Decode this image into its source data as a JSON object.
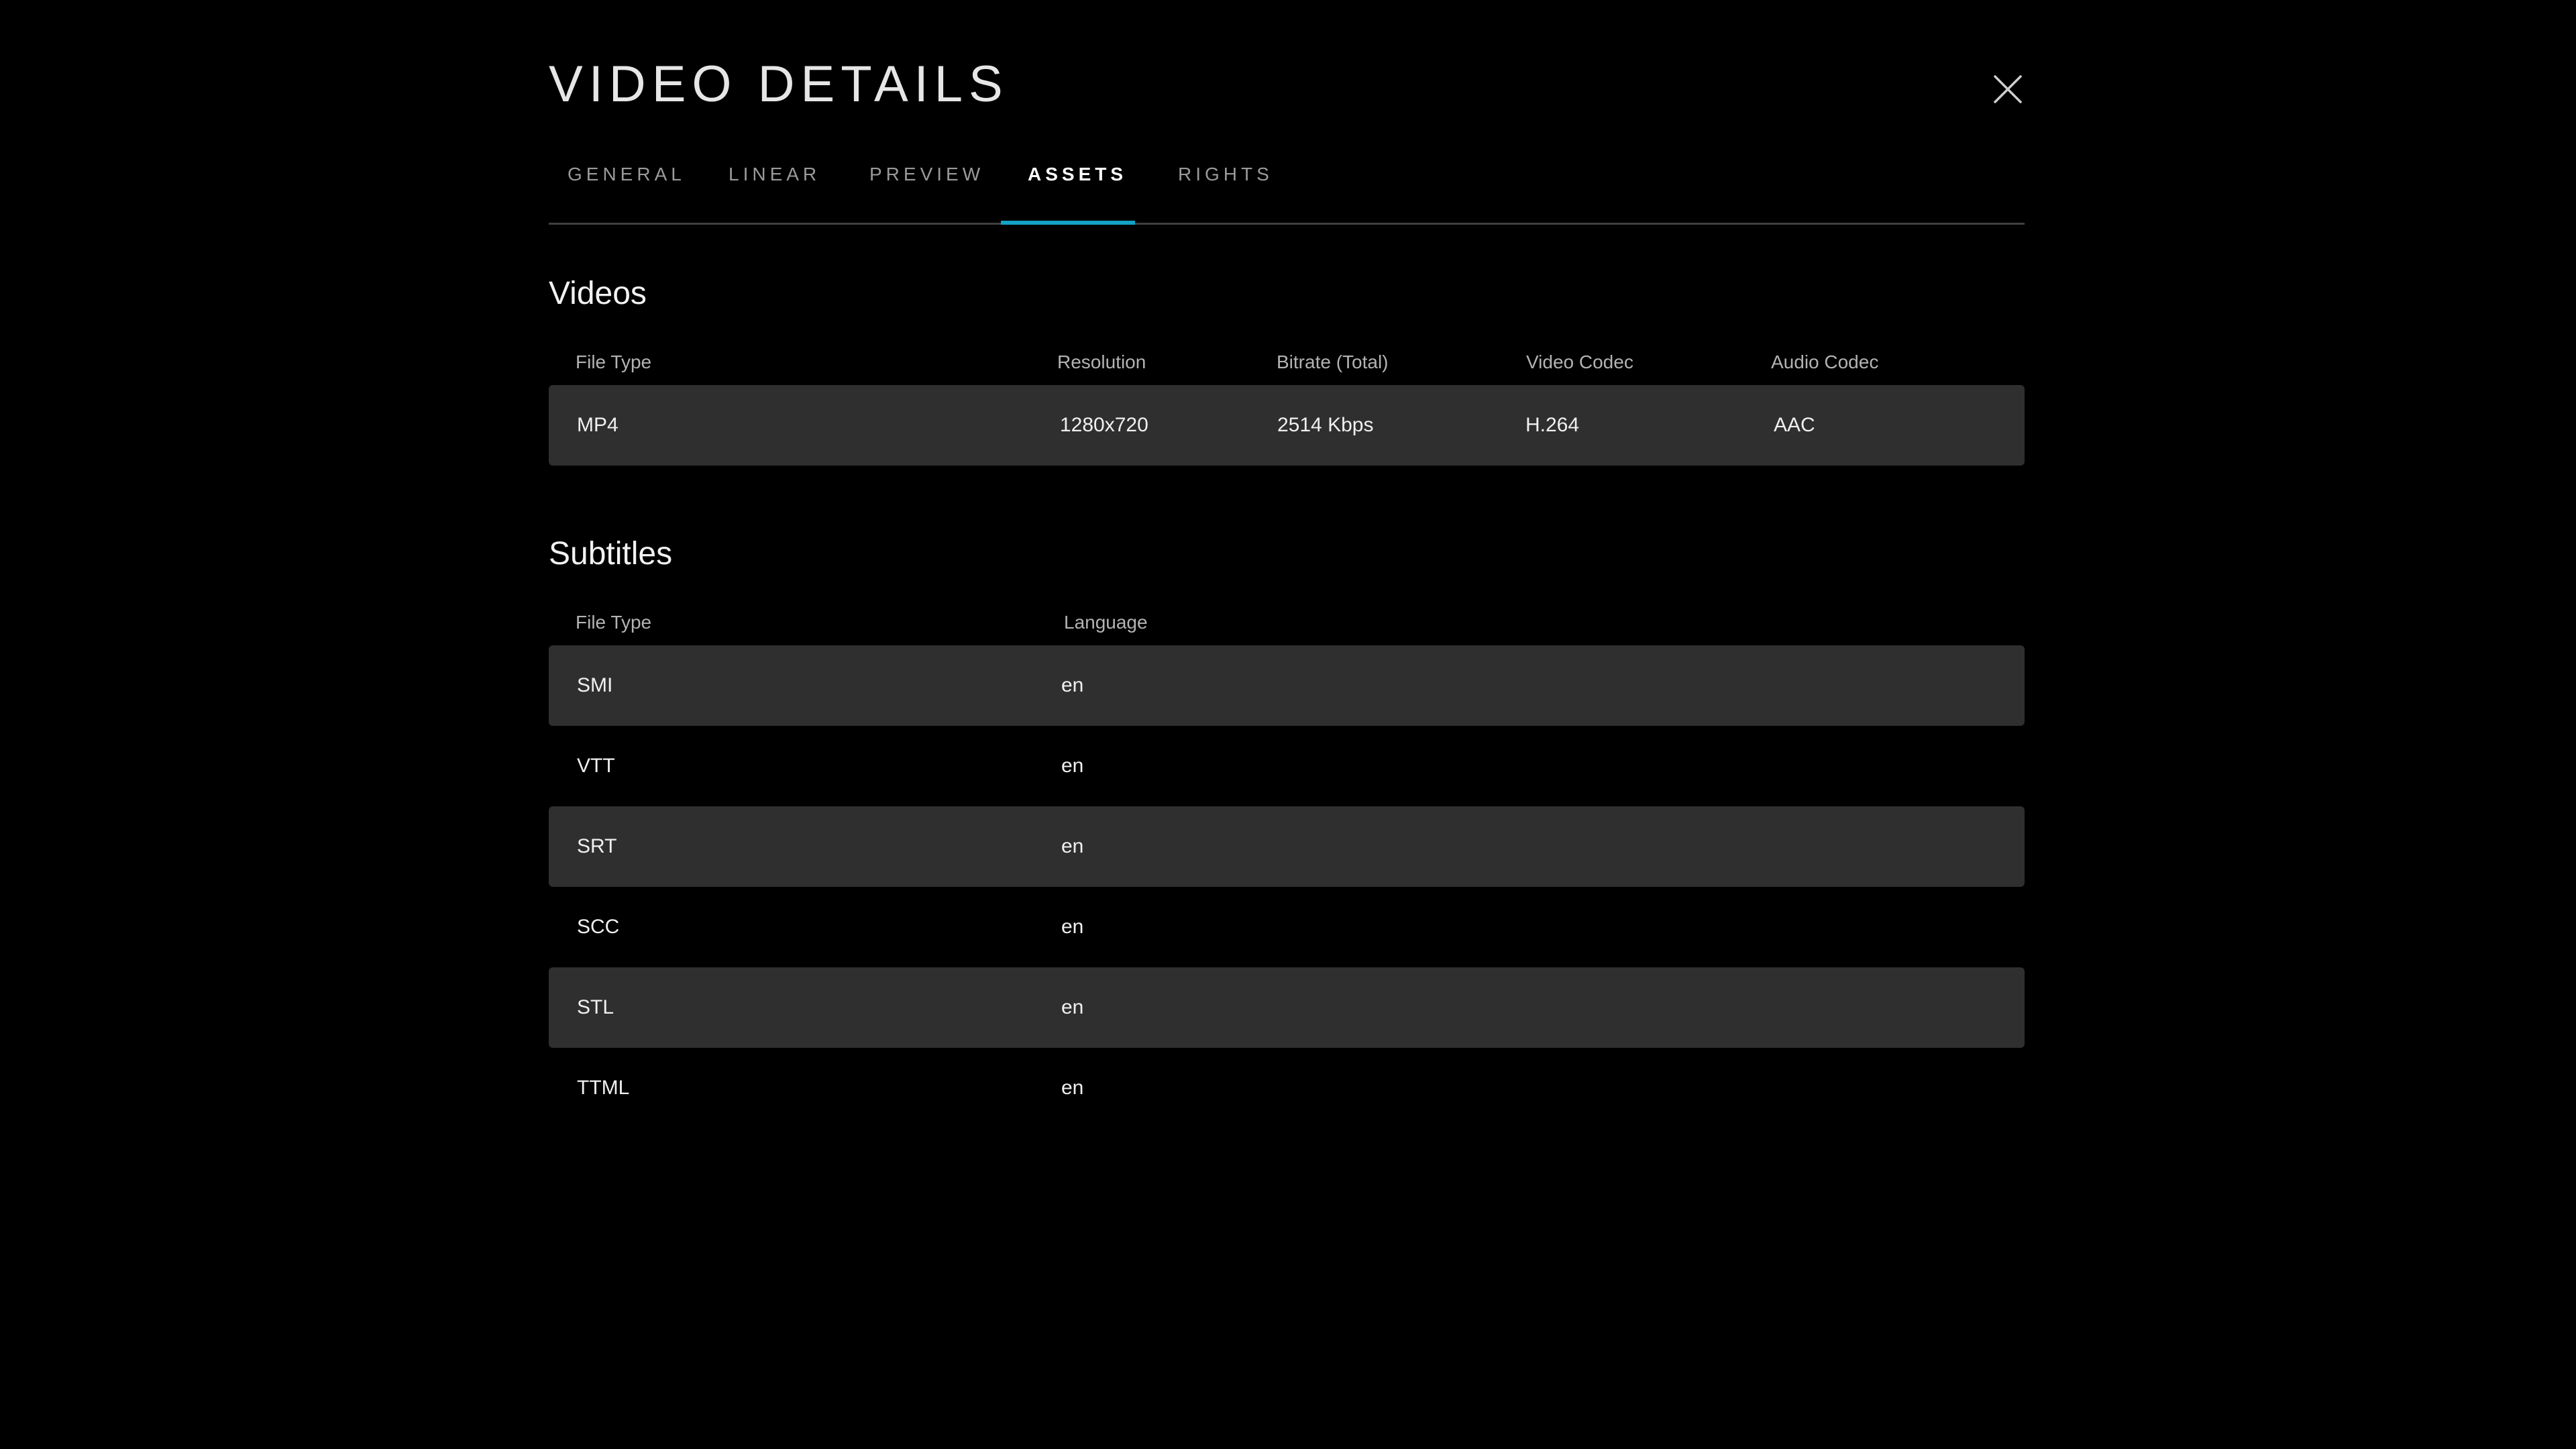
{
  "header": {
    "title": "VIDEO DETAILS"
  },
  "tabs": [
    {
      "label": "GENERAL",
      "active": false
    },
    {
      "label": "LINEAR",
      "active": false
    },
    {
      "label": "PREVIEW",
      "active": false
    },
    {
      "label": "ASSETS",
      "active": true
    },
    {
      "label": "RIGHTS",
      "active": false
    }
  ],
  "accent_color": "#13a3c4",
  "videos": {
    "title": "Videos",
    "columns": [
      "File Type",
      "Resolution",
      "Bitrate (Total)",
      "Video Codec",
      "Audio Codec"
    ],
    "rows": [
      {
        "file_type": "MP4",
        "resolution": "1280x720",
        "bitrate": "2514 Kbps",
        "video_codec": "H.264",
        "audio_codec": "AAC"
      }
    ]
  },
  "subtitles": {
    "title": "Subtitles",
    "columns": [
      "File Type",
      "Language"
    ],
    "rows": [
      {
        "file_type": "SMI",
        "language": "en"
      },
      {
        "file_type": "VTT",
        "language": "en"
      },
      {
        "file_type": "SRT",
        "language": "en"
      },
      {
        "file_type": "SCC",
        "language": "en"
      },
      {
        "file_type": "STL",
        "language": "en"
      },
      {
        "file_type": "TTML",
        "language": "en"
      }
    ]
  },
  "icons": {
    "close": "close-icon"
  }
}
